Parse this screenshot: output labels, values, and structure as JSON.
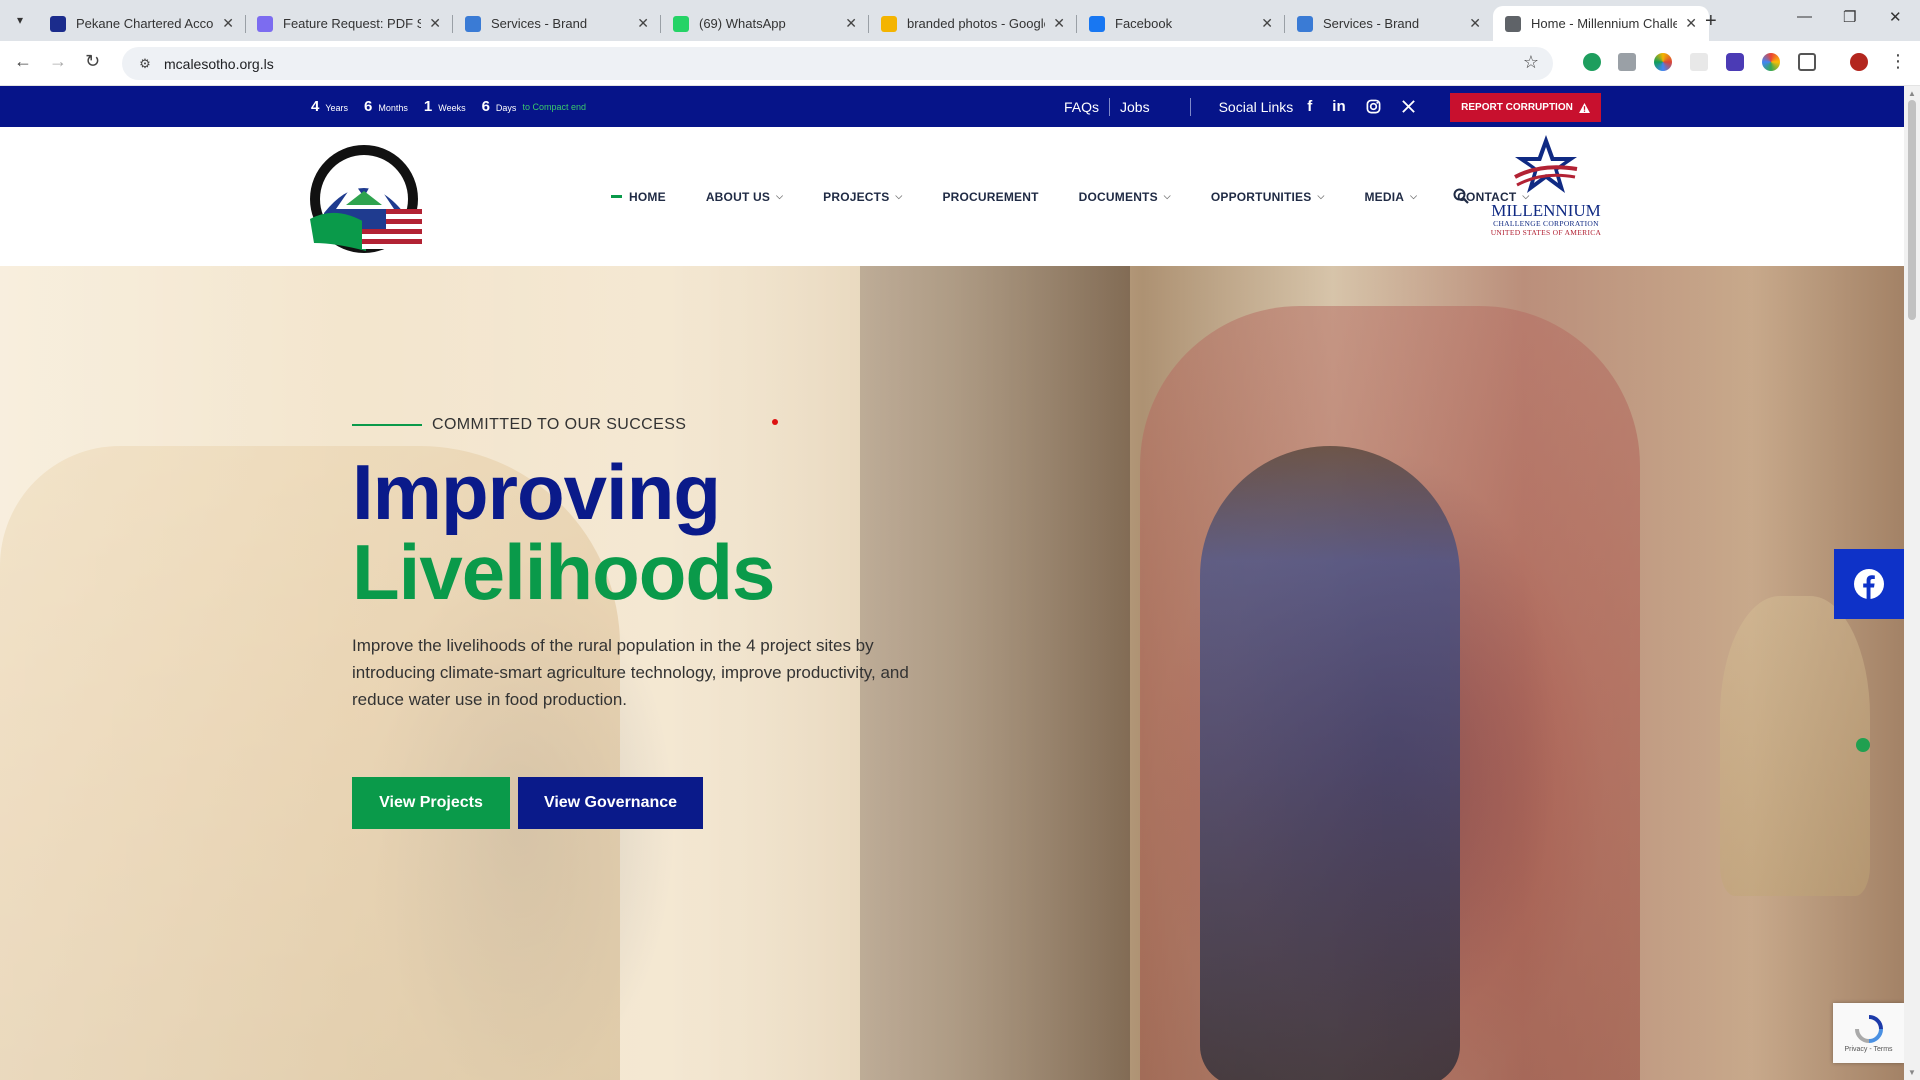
{
  "browser": {
    "tabs": [
      {
        "title": "Pekane Chartered Accoun",
        "favicon": "paypal-icon",
        "color": "#1b2c8c"
      },
      {
        "title": "Feature Request: PDF Sup",
        "favicon": "canva-icon",
        "color": "#7c6cf0"
      },
      {
        "title": "Services - Brand",
        "favicon": "brand-icon",
        "color": "#3a7bd5"
      },
      {
        "title": "(69) WhatsApp",
        "favicon": "whatsapp-icon",
        "color": "#25d366"
      },
      {
        "title": "branded photos - Google",
        "favicon": "google-drive-icon",
        "color": "#f4b400"
      },
      {
        "title": "Facebook",
        "favicon": "facebook-icon",
        "color": "#1877f2"
      },
      {
        "title": "Services - Brand",
        "favicon": "brand-icon",
        "color": "#3a7bd5"
      },
      {
        "title": "Home - Millennium Challe",
        "favicon": "globe-icon",
        "color": "#5f6368",
        "active": true
      }
    ],
    "url": "mcalesotho.org.ls"
  },
  "topbar": {
    "countdown": [
      {
        "num": "4",
        "unit": "Years"
      },
      {
        "num": "6",
        "unit": "Months"
      },
      {
        "num": "1",
        "unit": "Weeks"
      },
      {
        "num": "6",
        "unit": "Days"
      }
    ],
    "countdown_suffix": "to Compact end",
    "faqs": "FAQs",
    "jobs": "Jobs",
    "social_links": "Social Links",
    "report_btn": "REPORT CORRUPTION"
  },
  "nav": {
    "items": [
      {
        "label": "HOME",
        "active": true,
        "dropdown": false
      },
      {
        "label": "ABOUT US",
        "dropdown": true
      },
      {
        "label": "PROJECTS",
        "dropdown": true
      },
      {
        "label": "PROCUREMENT",
        "dropdown": false
      },
      {
        "label": "DOCUMENTS",
        "dropdown": true
      },
      {
        "label": "OPPORTUNITIES",
        "dropdown": true
      },
      {
        "label": "MEDIA",
        "dropdown": true
      },
      {
        "label": "CONTACT",
        "dropdown": true
      }
    ]
  },
  "mcc_logo": {
    "name": "MILLENNIUM",
    "sub1": "CHALLENGE CORPORATION",
    "sub2": "UNITED STATES OF AMERICA"
  },
  "hero": {
    "eyebrow": "COMMITTED TO OUR SUCCESS",
    "title_line1": "Improving",
    "title_line2": "Livelihoods",
    "description": "Improve the livelihoods of the rural population in the 4 project sites by introducing climate-smart agriculture technology, improve productivity, and reduce water use in food production.",
    "btn_projects": "View Projects",
    "btn_governance": "View Governance"
  },
  "recaptcha": {
    "text": "Privacy - Terms"
  },
  "colors": {
    "navy": "#061489",
    "green": "#0a9a4a",
    "red": "#c8102e"
  }
}
